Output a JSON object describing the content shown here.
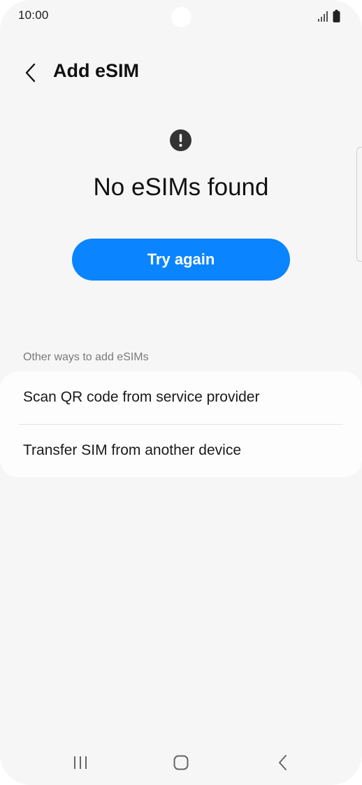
{
  "status_bar": {
    "time": "10:00",
    "signal_icon": "signal-icon",
    "battery_icon": "battery-icon"
  },
  "header": {
    "title": "Add eSIM",
    "back_icon": "chevron-left-icon"
  },
  "empty_state": {
    "icon": "alert-circle-icon",
    "message": "No eSIMs found",
    "button_label": "Try again"
  },
  "other_ways": {
    "section_label": "Other ways to add eSIMs",
    "items": [
      {
        "label": "Scan QR code from service provider"
      },
      {
        "label": "Transfer SIM from another device"
      }
    ]
  },
  "nav_bar": {
    "recents_icon": "recents-icon",
    "home_icon": "home-icon",
    "back_icon": "back-icon"
  },
  "colors": {
    "accent": "#0a84ff",
    "background": "#f6f6f6",
    "card": "#fdfdfd"
  }
}
